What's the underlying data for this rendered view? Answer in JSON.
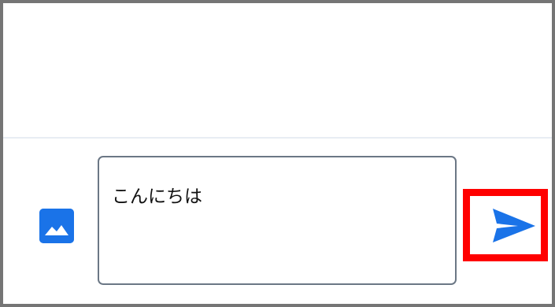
{
  "composer": {
    "message_value": "こんにちは",
    "image_icon": "image-icon",
    "send_icon": "send-icon",
    "accent_color": "#1a73e8",
    "highlight_color": "#ff0000"
  }
}
